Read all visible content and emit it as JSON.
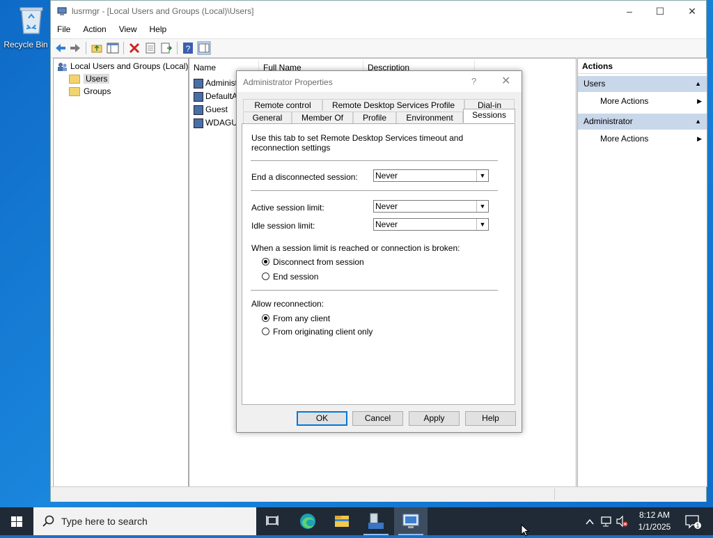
{
  "desktop": {
    "recycle_bin_label": "Recycle Bin"
  },
  "window": {
    "title": "lusrmgr - [Local Users and Groups (Local)\\Users]",
    "menu": [
      "File",
      "Action",
      "View",
      "Help"
    ],
    "tree": {
      "root": "Local Users and Groups (Local)",
      "items": [
        "Users",
        "Groups"
      ]
    },
    "list": {
      "columns": [
        "Name",
        "Full Name",
        "Description"
      ],
      "rows": [
        "Administ",
        "DefaultA",
        "Guest",
        "WDAGU"
      ]
    },
    "actions": {
      "header": "Actions",
      "sections": [
        {
          "title": "Users",
          "item": "More Actions"
        },
        {
          "title": "Administrator",
          "item": "More Actions"
        }
      ]
    }
  },
  "dialog": {
    "title": "Administrator Properties",
    "help_glyph": "?",
    "tabs_row1": [
      "Remote control",
      "Remote Desktop Services Profile",
      "Dial-in"
    ],
    "tabs_row2": [
      "General",
      "Member Of",
      "Profile",
      "Environment",
      "Sessions"
    ],
    "intro": "Use this tab to set Remote Desktop Services timeout and reconnection settings",
    "end_disconnected_label": "End a disconnected session:",
    "end_disconnected_value": "Never",
    "active_limit_label": "Active session limit:",
    "active_limit_value": "Never",
    "idle_limit_label": "Idle session limit:",
    "idle_limit_value": "Never",
    "limit_reached_label": "When a session limit is reached or connection is broken:",
    "radio_disconnect": "Disconnect from session",
    "radio_end": "End session",
    "allow_reconnection_label": "Allow reconnection:",
    "radio_any_client": "From any client",
    "radio_originating": "From originating client only",
    "buttons": {
      "ok": "OK",
      "cancel": "Cancel",
      "apply": "Apply",
      "help": "Help"
    }
  },
  "taskbar": {
    "search_placeholder": "Type here to search",
    "time": "8:12 AM",
    "date": "1/1/2025"
  }
}
